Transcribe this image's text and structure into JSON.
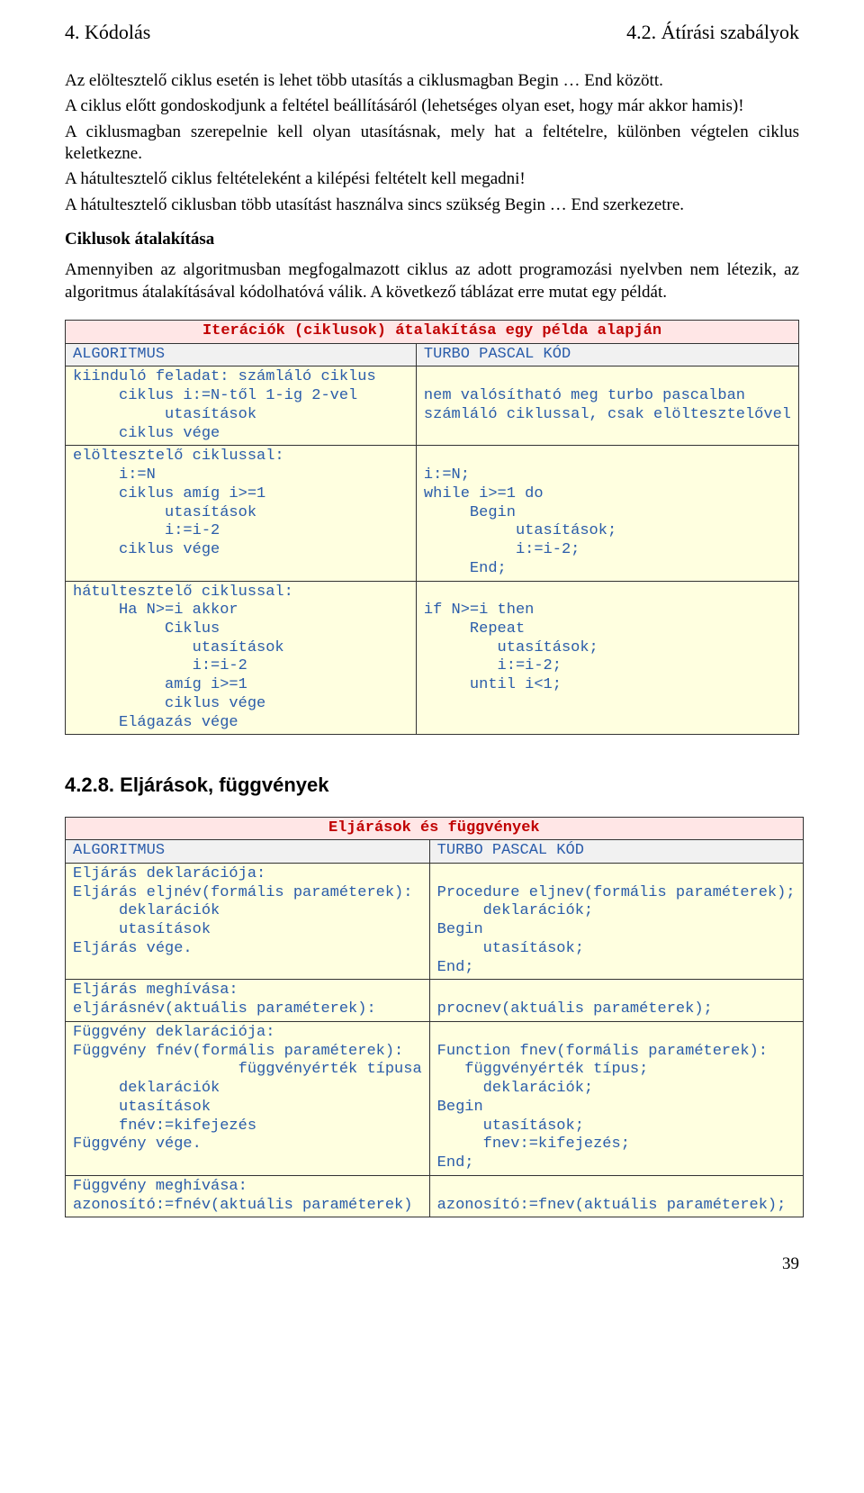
{
  "header": {
    "left": "4. Kódolás",
    "right": "4.2. Átírási szabályok"
  },
  "p1": "Az elöltesztelő ciklus esetén is lehet több utasítás a ciklusmagban Begin … End között.",
  "p2": "A ciklus előtt gondoskodjunk a feltétel beállításáról (lehetséges olyan eset, hogy már akkor hamis)!",
  "p3": "A ciklusmagban szerepelnie kell olyan utasításnak, mely hat a feltételre, különben végtelen ciklus keletkezne.",
  "p4": "A hátultesztelő ciklus feltételeként a kilépési feltételt kell megadni!",
  "p5": "A hátultesztelő ciklusban több utasítást használva sincs szükség Begin … End szerkezetre.",
  "sub1": "Ciklusok átalakítása",
  "p6": "Amennyiben az algoritmusban megfogalmazott ciklus az adott programozási nyelvben nem létezik, az algoritmus átalakításával kódolhatóvá válik. A következő táblázat erre mutat egy példát.",
  "table1": {
    "title": "Iterációk (ciklusok) átalakítása egy példa alapján",
    "hL": "ALGORITMUS",
    "hR": "TURBO PASCAL KÓD",
    "r1L": "kiinduló feladat: számláló ciklus\n     ciklus i:=N-től 1-ig 2-vel\n          utasítások\n     ciklus vége",
    "r1R": "\nnem valósítható meg turbo pascalban\nszámláló ciklussal, csak elöltesztelővel",
    "r2L": "elöltesztelő ciklussal:\n     i:=N\n     ciklus amíg i>=1\n          utasítások\n          i:=i-2\n     ciklus vége",
    "r2R": "\ni:=N;\nwhile i>=1 do\n     Begin\n          utasítások;\n          i:=i-2;\n     End;",
    "r3L": "hátultesztelő ciklussal:\n     Ha N>=i akkor\n          Ciklus\n             utasítások\n             i:=i-2\n          amíg i>=1\n          ciklus vége\n     Elágazás vége",
    "r3R": "\nif N>=i then\n     Repeat\n        utasítások;\n        i:=i-2;\n     until i<1;"
  },
  "section2": "4.2.8. Eljárások, függvények",
  "table2": {
    "title": "Eljárások és függvények",
    "hL": "ALGORITMUS",
    "hR": "TURBO PASCAL KÓD",
    "r1L": "Eljárás deklarációja:\nEljárás eljnév(formális paraméterek):\n     deklarációk\n     utasítások\nEljárás vége.",
    "r1R": "\nProcedure eljnev(formális paraméterek);\n     deklarációk;\nBegin\n     utasítások;\nEnd;",
    "r2L": "Eljárás meghívása:\neljárásnév(aktuális paraméterek):",
    "r2R": "\nprocnev(aktuális paraméterek);",
    "r3L": "Függvény deklarációja:\nFüggvény fnév(formális paraméterek):\n                  függvényérték típusa\n     deklarációk\n     utasítások\n     fnév:=kifejezés\nFüggvény vége.",
    "r3R": "\nFunction fnev(formális paraméterek):\n   függvényérték típus;\n     deklarációk;\nBegin\n     utasítások;\n     fnev:=kifejezés;\nEnd;",
    "r4L": "Függvény meghívása:\nazonosító:=fnév(aktuális paraméterek)",
    "r4R": "\nazonosító:=fnev(aktuális paraméterek);"
  },
  "pagenum": "39"
}
